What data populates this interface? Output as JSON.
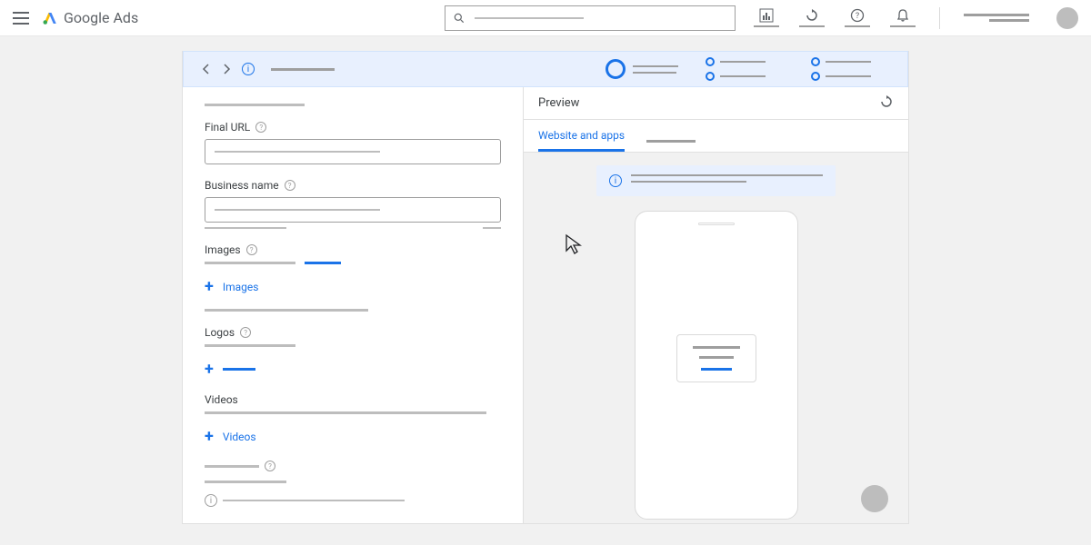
{
  "header": {
    "product_name": "Google",
    "product_suffix": "Ads",
    "search_placeholder": ""
  },
  "stepper": {
    "current_step": 1
  },
  "form": {
    "final_url_label": "Final URL",
    "business_name_label": "Business name",
    "images_label": "Images",
    "add_images_label": "Images",
    "logos_label": "Logos",
    "videos_label": "Videos",
    "add_videos_label": "Videos"
  },
  "preview": {
    "title": "Preview",
    "tabs": {
      "active": "Website and apps"
    }
  }
}
